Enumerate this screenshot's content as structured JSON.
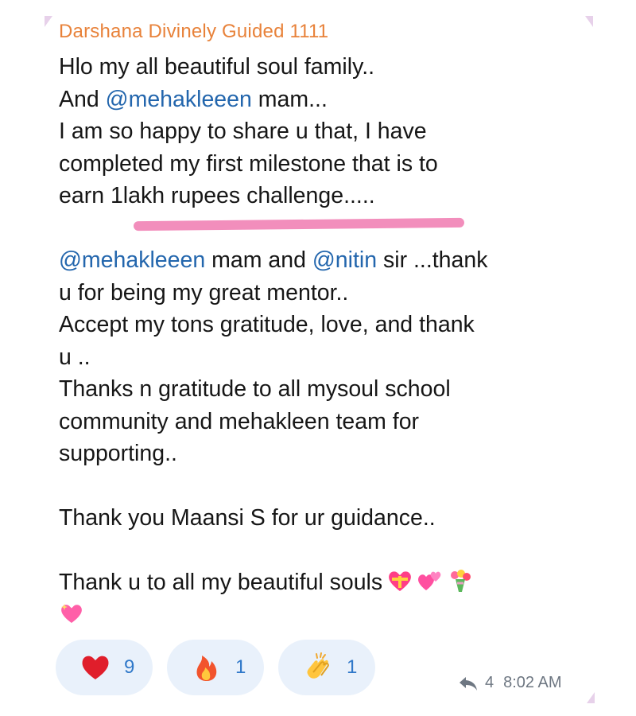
{
  "message": {
    "sender_name": "Darshana Divinely Guided 1111",
    "lines": [
      {
        "text": "Hlo my all beautiful soul family.."
      },
      {
        "prefix": "And ",
        "mention": "@mehakleeen",
        "suffix": " mam..."
      },
      {
        "text": "I am so happy to share u that, I have"
      },
      {
        "text": "completed my first milestone that is to"
      },
      {
        "text": "earn  1lakh rupees challenge....."
      },
      {
        "text": ""
      },
      {
        "mention1": "@mehakleeen",
        "mid": " mam and ",
        "mention2": "@nitin",
        "suffix": " sir ...thank"
      },
      {
        "text": "u for being my great mentor.."
      },
      {
        "text": "Accept my tons  gratitude, love, and thank"
      },
      {
        "text": "u .."
      },
      {
        "text": "Thanks n gratitude to all mysoul school"
      },
      {
        "text": "community and mehakleen team for"
      },
      {
        "text": "supporting.."
      },
      {
        "text": ""
      },
      {
        "text": "Thank you Maansi S for ur guidance.."
      },
      {
        "text": ""
      },
      {
        "text": "Thank u to all my beautiful souls"
      }
    ],
    "emojis": [
      "heart-with-ribbon-icon",
      "two-hearts-icon",
      "bouquet-icon",
      "sparkling-heart-icon"
    ]
  },
  "reactions": [
    {
      "icon": "heart-icon",
      "count": "9"
    },
    {
      "icon": "fire-icon",
      "count": "1"
    },
    {
      "icon": "clapping-hands-icon",
      "count": "1"
    }
  ],
  "meta": {
    "reply_count": "4",
    "time": "8:02 AM"
  },
  "colors": {
    "sender": "#e8823a",
    "mention": "#2366ad",
    "reaction_bg": "#e9f1fb",
    "reaction_count": "#2f78c9",
    "highlight": "#f07ab0"
  }
}
